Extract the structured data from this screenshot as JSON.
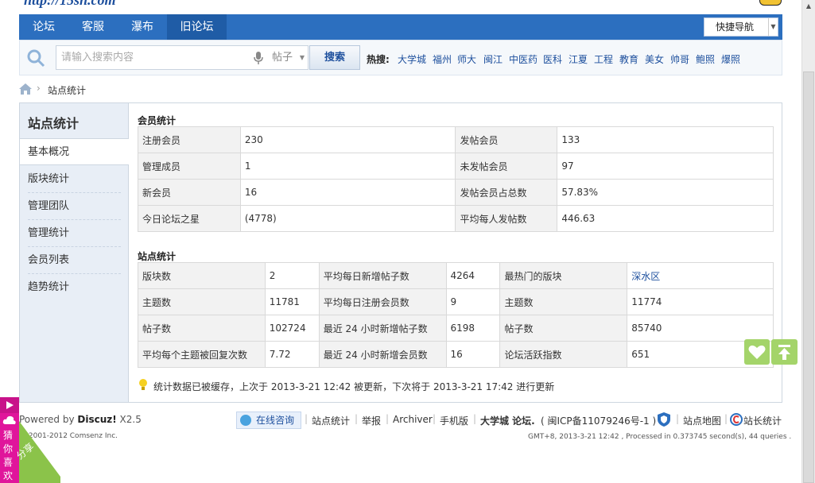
{
  "site": {
    "logo_text": "http://15sn.com"
  },
  "nav": {
    "items": [
      {
        "label": "论坛"
      },
      {
        "label": "客服"
      },
      {
        "label": "瀑布"
      },
      {
        "label": "旧论坛"
      }
    ],
    "quick_nav_label": "快捷导航"
  },
  "search": {
    "placeholder": "请输入搜索内容",
    "type_value": "帖子",
    "button_label": "搜索",
    "hot_label": "热搜:",
    "hot_links": [
      "大学城",
      "福州",
      "师大",
      "闽江",
      "中医药",
      "医科",
      "江夏",
      "工程",
      "教育",
      "美女",
      "帅哥",
      "鲍照",
      "爆照"
    ]
  },
  "breadcrumb": {
    "sep": "›",
    "current": "站点统计"
  },
  "sidebar": {
    "title": "站点统计",
    "items": [
      "基本概况",
      "版块统计",
      "管理团队",
      "管理统计",
      "会员列表",
      "趋势统计"
    ]
  },
  "member_stats": {
    "title": "会员统计",
    "rows": [
      [
        "注册会员",
        "230",
        "发帖会员",
        "133"
      ],
      [
        "管理成员",
        "1",
        "未发帖会员",
        "97"
      ],
      [
        "新会员",
        "16",
        "发帖会员占总数",
        "57.83%"
      ],
      [
        "今日论坛之星",
        "(4778)",
        "平均每人发帖数",
        "446.63"
      ]
    ]
  },
  "site_stats": {
    "title": "站点统计",
    "rows": [
      [
        "版块数",
        "2",
        "平均每日新增帖子数",
        "4264",
        "最热门的版块",
        "深水区"
      ],
      [
        "主题数",
        "11781",
        "平均每日注册会员数",
        "9",
        "主题数",
        "11774"
      ],
      [
        "帖子数",
        "102724",
        "最近 24 小时新增帖子数",
        "6198",
        "帖子数",
        "85740"
      ],
      [
        "平均每个主题被回复次数",
        "7.72",
        "最近 24 小时新增会员数",
        "16",
        "论坛活跃指数",
        "651"
      ]
    ]
  },
  "cache_note": "统计数据已被缓存，上次于 2013-3-21 12:42 被更新，下次将于 2013-3-21 17:42 进行更新",
  "footer": {
    "powered_prefix": "Powered by ",
    "powered_brand": "Discuz!",
    "powered_version": " X2.5",
    "copyright": "© 2001-2012 Comsenz Inc.",
    "consult_label": "在线咨询",
    "links": [
      "站点统计",
      "举报",
      "Archiver",
      "手机版"
    ],
    "site_name": "大学城 论坛.",
    "icp": "( 闽ICP备11079246号-1 )",
    "sitemap": "站点地图",
    "webmaster_stats": "站长统计",
    "gmt_line": "GMT+8, 2013-3-21 12:42 , Processed in 0.373745 second(s), 44 queries ."
  },
  "side_widget": {
    "guess_text": "猜你喜欢",
    "share_text": "分享"
  },
  "colors": {
    "nav_blue": "#2c6fbf",
    "link_blue": "#1d4f9d",
    "guess_pink": "#e0159b",
    "float_green": "#a4d46a"
  }
}
